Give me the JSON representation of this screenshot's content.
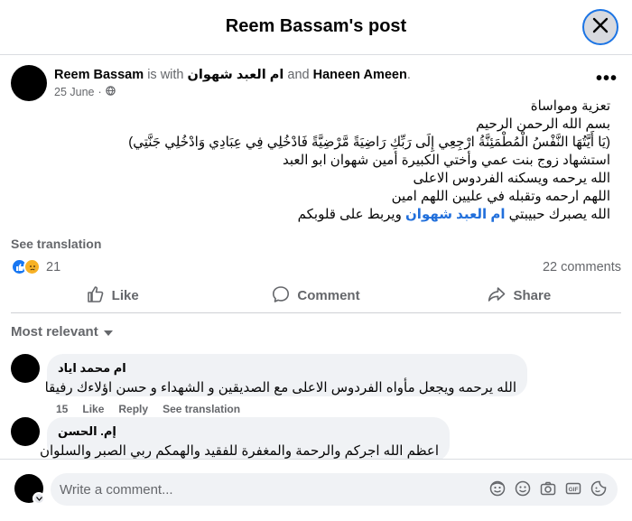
{
  "header": {
    "title": "Reem Bassam's post",
    "close_icon": "close-icon"
  },
  "post": {
    "author": "Reem Bassam",
    "is_with": "is with",
    "tagged_1": "ام العبد شهوان",
    "and": "and",
    "tagged_2": "Haneen Ameen",
    "period": ".",
    "date": "25 June",
    "separator": "·",
    "privacy_icon": "globe-icon",
    "more_label": "•••",
    "lines": [
      "تعزية ومواساة",
      "بسم الله الرحمن الرحيم",
      "(يَا أَيَّتُهَا النَّفْسُ الْمُطْمَئِنَّةُ ارْجِعِي إِلَى رَبِّكِ رَاضِيَةً مَّرْضِيَّةً فَادْخُلِي فِي عِبَادِي وَادْخُلِي جَنَّتِي)",
      "استشهاد زوج بنت عمي وأختي الكبيرة أمين  شهوان  ابو العبد",
      "الله يرحمه ويسكنه الفردوس الاعلى",
      "اللهم ارحمه وتقبله في عليين اللهم امين"
    ],
    "last_line_start": "الله يصبرك حبيبتي ",
    "last_line_mention": "ام العبد شهوان",
    "last_line_end": " ويربط على قلوبكم",
    "see_translation": "See translation",
    "reaction_count": "21",
    "comments_count": "22 comments"
  },
  "actions": {
    "like": "Like",
    "comment": "Comment",
    "share": "Share"
  },
  "filter": {
    "label": "Most relevant"
  },
  "comments": [
    {
      "author": "ام محمد اياد",
      "text": "الله يرحمه ويجعل مأواه الفردوس الاعلى مع الصديقين و الشهداء و حسن اؤلاءك رفيقا",
      "likes": "15",
      "like_label": "Like",
      "reply_label": "Reply",
      "translation_label": "See translation"
    },
    {
      "author": "إم. الحسن",
      "text": "اعظم الله اجركم والرحمة والمغفرة للفقيد والهمكم ربي الصبر والسلوان"
    }
  ],
  "composer": {
    "placeholder": "Write a comment...",
    "icons": [
      "avatar-sticker-icon",
      "emoji-icon",
      "camera-icon",
      "gif-icon",
      "sticker-icon"
    ]
  },
  "colors": {
    "accent": "#1877f2",
    "mention": "#216fdb",
    "muted": "#65676b",
    "bubble": "#f0f2f5"
  }
}
